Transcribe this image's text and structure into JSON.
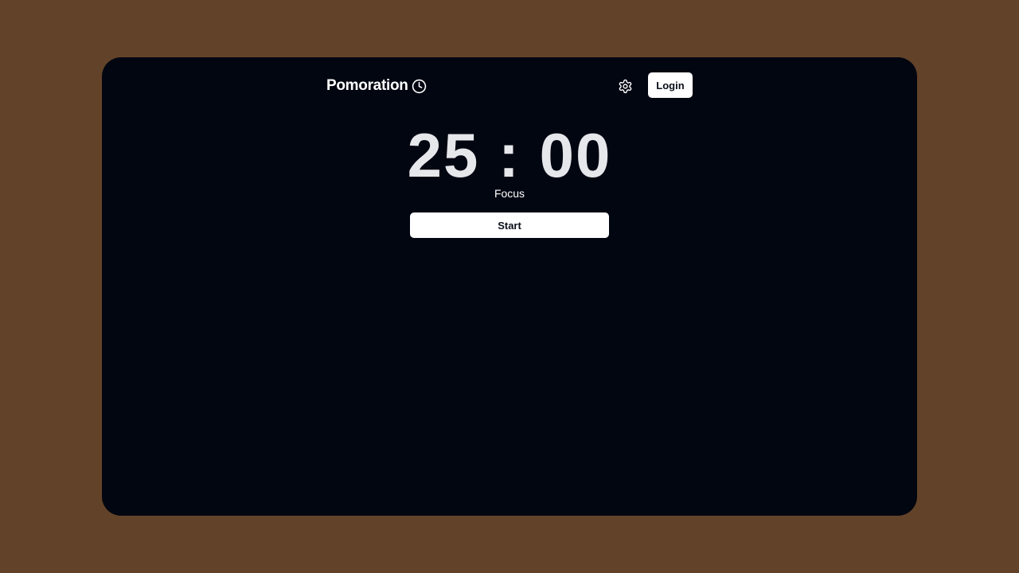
{
  "header": {
    "brand_name": "Pomoration",
    "brand_icon": "clock-icon",
    "settings_icon": "gear-icon",
    "login_label": "Login"
  },
  "timer": {
    "display": "25 : 00",
    "mode": "Focus",
    "start_label": "Start"
  },
  "colors": {
    "page_background": "#624329",
    "window_background": "#020611",
    "timer_text": "#e5e7eb",
    "button_background": "#ffffff"
  }
}
